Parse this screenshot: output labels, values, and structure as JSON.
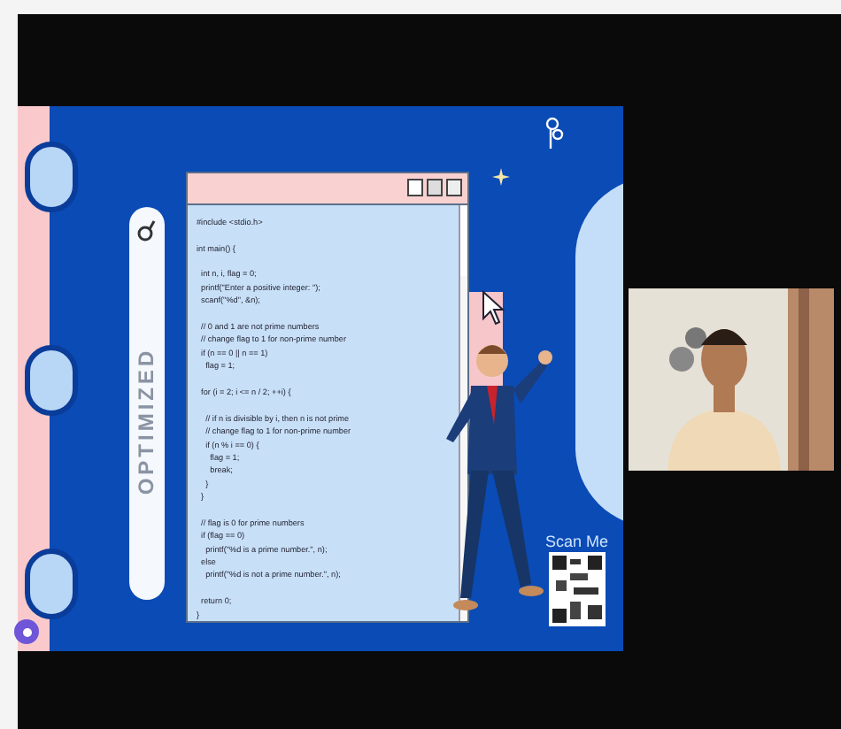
{
  "slide": {
    "vertical_label": "OPTIMIZED",
    "code_window": {
      "blocks": [
        [
          "#include <stdio.h>"
        ],
        [
          "int main() {"
        ],
        [
          "  int n, i, flag = 0;",
          "  printf(\"Enter a positive integer: \");",
          "  scanf(\"%d\", &n);"
        ],
        [
          "  // 0 and 1 are not prime numbers",
          "  // change flag to 1 for non-prime number",
          "  if (n == 0 || n == 1)",
          "    flag = 1;"
        ],
        [
          "  for (i = 2; i <= n / 2; ++i) {"
        ],
        [
          "    // if n is divisible by i, then n is not prime",
          "    // change flag to 1 for non-prime number",
          "    if (n % i == 0) {",
          "      flag = 1;",
          "      break;",
          "    }",
          "  }"
        ],
        [
          "  // flag is 0 for prime numbers",
          "  if (flag == 0)",
          "    printf(\"%d is a prime number.\", n);",
          "  else",
          "    printf(\"%d is not a prime number.\", n);"
        ],
        [
          "  return 0;",
          "}"
        ]
      ]
    },
    "scan_label": "Scan Me"
  }
}
